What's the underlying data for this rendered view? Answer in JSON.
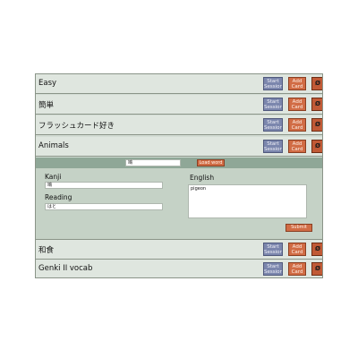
{
  "buttons": {
    "start_session": "Start Session",
    "add_card": "Add Card",
    "delete": "Ø"
  },
  "decks_before": [
    {
      "name": "Easy"
    },
    {
      "name": "簡単"
    },
    {
      "name": "フラッシュカード好き"
    },
    {
      "name": "Animals"
    }
  ],
  "add_card_form": {
    "lookup_value": "鳩",
    "load_word_label": "Load word",
    "kanji_label": "Kanji",
    "kanji_value": "鳩",
    "reading_label": "Reading",
    "reading_value": "はと",
    "english_label": "English",
    "english_value": "pigeon",
    "submit_label": "Submit"
  },
  "decks_after": [
    {
      "name": "和食"
    },
    {
      "name": "Genki II vocab"
    }
  ],
  "colors": {
    "start_button": "#7b86ad",
    "add_button": "#d16c45",
    "delete_button": "#c15a36",
    "row_background": "#dfe6df",
    "form_background": "#c5d2c6",
    "form_header": "#8fa797"
  }
}
